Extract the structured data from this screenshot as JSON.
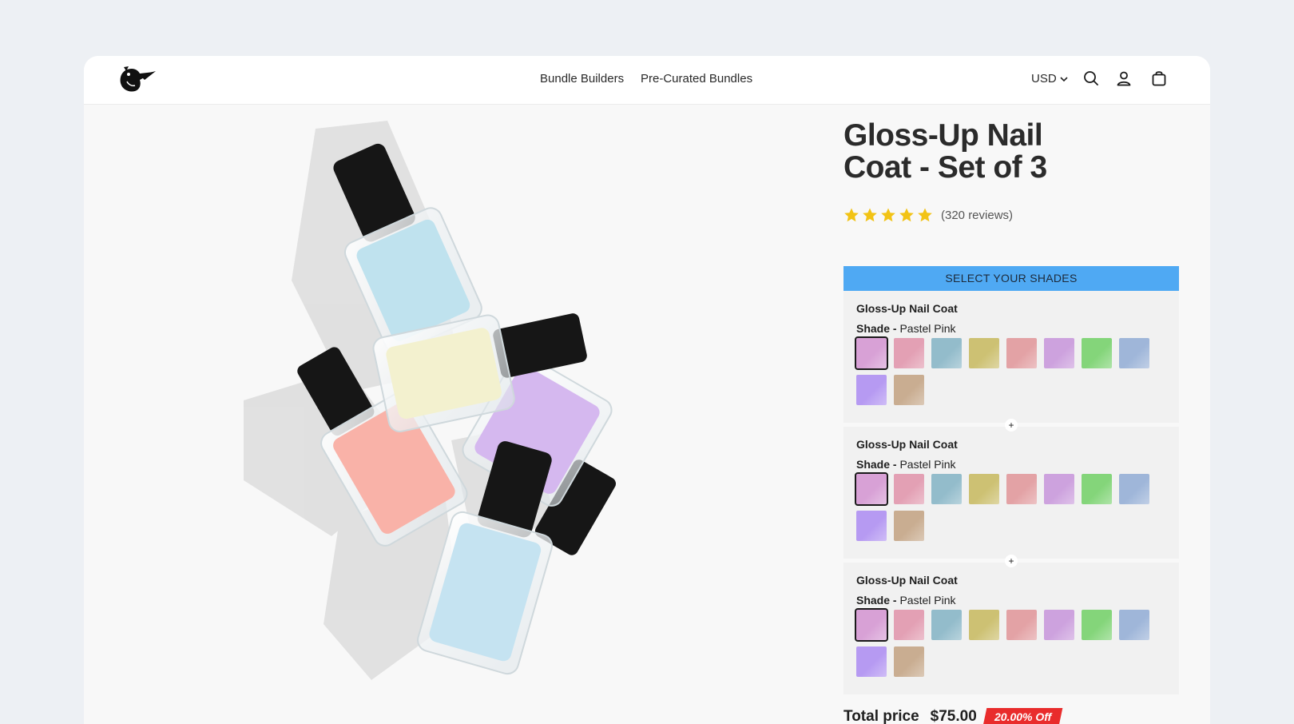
{
  "header": {
    "nav": [
      "Bundle Builders",
      "Pre-Curated Bundles"
    ],
    "currency": "USD",
    "icons": [
      "logo-icon",
      "search-icon",
      "account-icon",
      "cart-icon"
    ]
  },
  "product": {
    "title": "Gloss-Up Nail Coat - Set of 3",
    "rating": 5,
    "reviews": "(320 reviews)"
  },
  "selector": {
    "heading": "SELECT YOUR SHADES",
    "items": [
      {
        "name": "Gloss-Up Nail Coat",
        "shade_label": "Shade -",
        "shade_value": "Pastel Pink",
        "selected_index": 0
      },
      {
        "name": "Gloss-Up Nail Coat",
        "shade_label": "Shade -",
        "shade_value": "Pastel Pink",
        "selected_index": 0
      },
      {
        "name": "Gloss-Up Nail Coat",
        "shade_label": "Shade -",
        "shade_value": "Pastel Pink",
        "selected_index": 0
      }
    ],
    "swatch_colors": [
      "#d8a1d6",
      "#e3a0b4",
      "#93bccb",
      "#cdc173",
      "#e3a2a5",
      "#cda2de",
      "#84d57a",
      "#9fb6d9",
      "#b69af2",
      "#c9ad91"
    ],
    "separator": "+"
  },
  "pricing": {
    "label": "Total price",
    "price": "$75.00",
    "discount": "20.00% Off"
  },
  "colors": {
    "accent": "#4fa9f3",
    "star": "#f2c315",
    "discount": "#e92c2c"
  }
}
